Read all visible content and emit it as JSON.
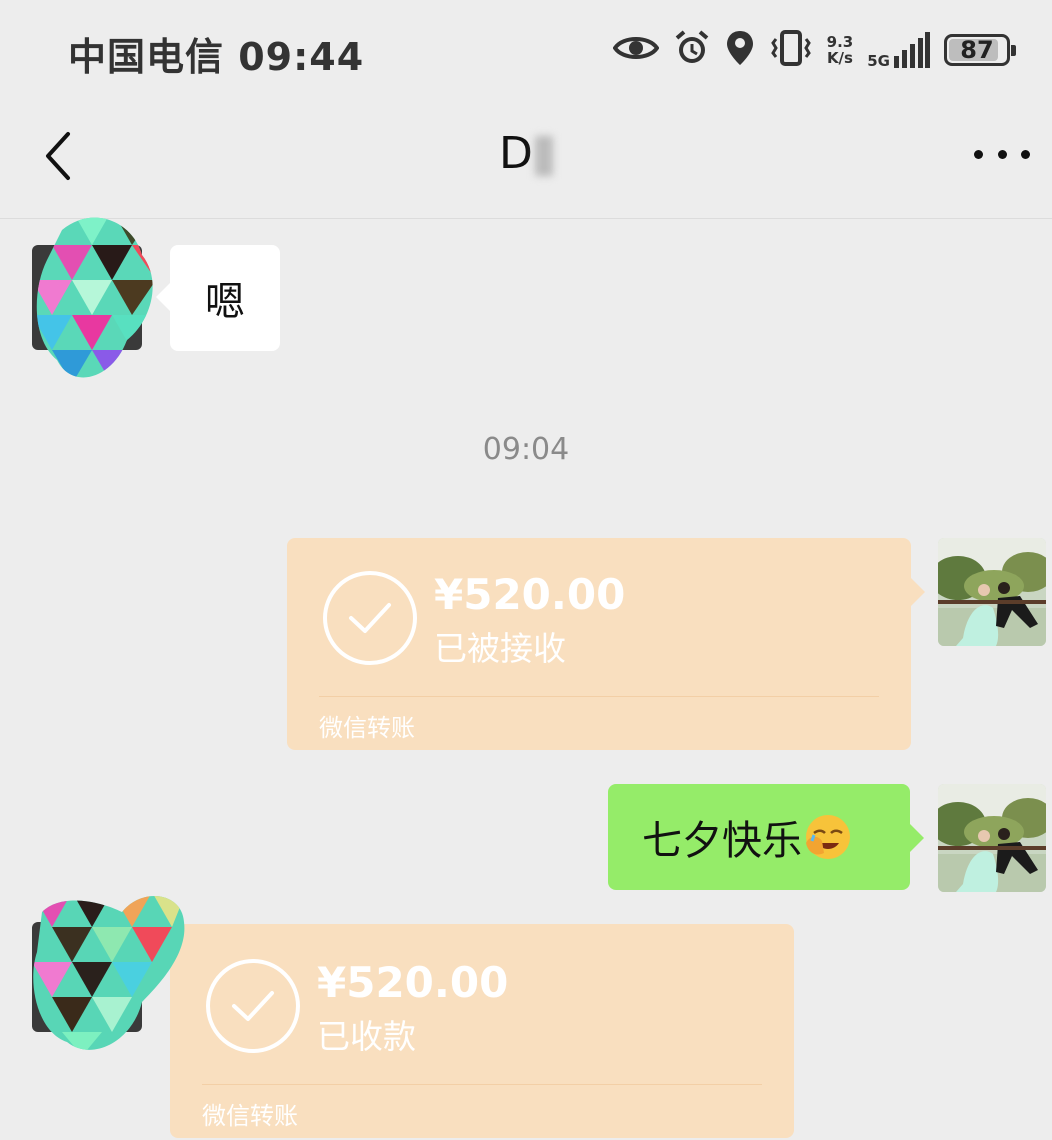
{
  "status_bar": {
    "carrier_time": "中国电信 09:44",
    "network_speed_value": "9.3",
    "network_speed_unit": "K/s",
    "network_type": "5G",
    "battery_level": "87",
    "battery_fraction": 0.87
  },
  "nav": {
    "title": "D"
  },
  "messages": {
    "incoming_text": "嗯",
    "timestamp": "09:04",
    "transfer_out": {
      "amount": "¥520.00",
      "status": "已被接收",
      "footer": "微信转账"
    },
    "outgoing_text": "七夕快乐",
    "transfer_in": {
      "amount": "¥520.00",
      "status": "已收款",
      "footer": "微信转账"
    }
  },
  "colors": {
    "background": "#ededed",
    "transfer_bubble": "#f9dfbf",
    "outgoing_bubble": "#95ec69",
    "incoming_bubble": "#ffffff"
  }
}
